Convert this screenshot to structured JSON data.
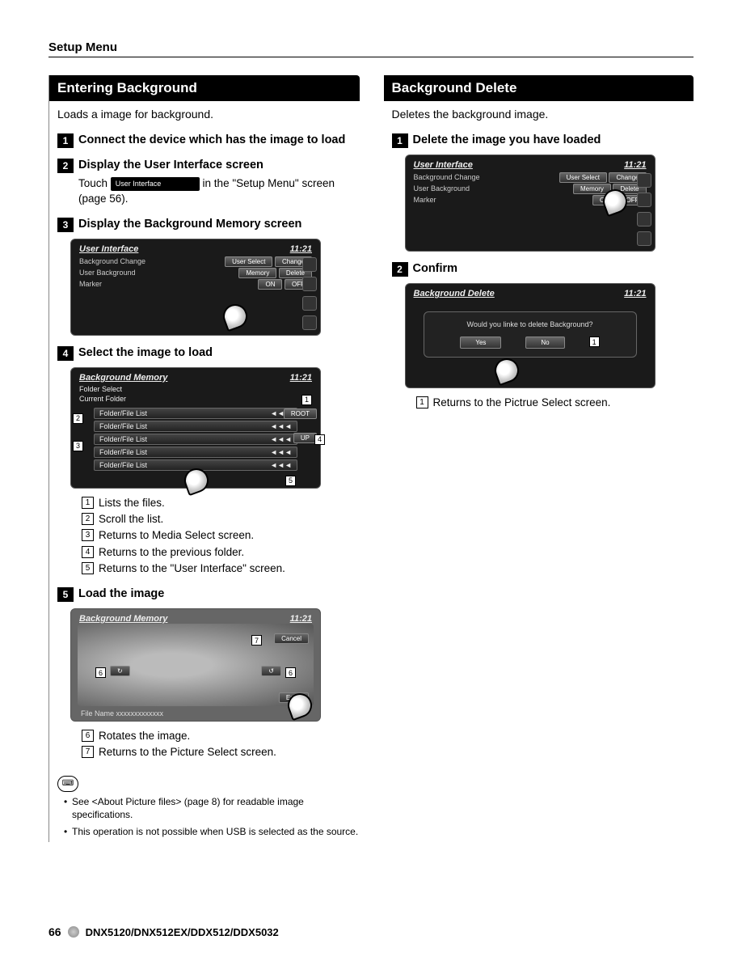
{
  "watermark": "",
  "header": "Setup Menu",
  "footer": {
    "page": "66",
    "models": "DNX5120/DNX512EX/DDX512/DDX5032"
  },
  "left": {
    "section_title": "Entering Background",
    "intro": "Loads a image for background.",
    "step1": {
      "num": "1",
      "title": "Connect the device which has the image to load"
    },
    "step2": {
      "num": "2",
      "title": "Display the User Interface screen",
      "body_pre": "Touch ",
      "inline_btn": "User Interface",
      "body_post": " in the \"Setup Menu\" screen (page 56)."
    },
    "step3": {
      "num": "3",
      "title": "Display the Background Memory screen",
      "ui": {
        "title": "User Interface",
        "time": "11:21",
        "row1_label": "Background Change",
        "row1_btn1": "User Select",
        "row1_btn2": "Change",
        "row2_label": "User Background",
        "row2_btn1": "Memory",
        "row2_btn2": "Delete",
        "row3_label": "Marker",
        "row3_on": "ON",
        "row3_off": "OFF"
      }
    },
    "step4": {
      "num": "4",
      "title": "Select the image to load",
      "ui": {
        "title": "Background Memory",
        "time": "11:21",
        "sub1": "Folder Select",
        "sub2": "Current Folder",
        "item": "Folder/File List",
        "arrows": "◄◄◄",
        "root": "ROOT",
        "up": "UP"
      },
      "callouts": [
        "Lists the files.",
        "Scroll the list.",
        "Returns to Media Select screen.",
        "Returns to the previous folder.",
        "Returns to the \"User Interface\" screen."
      ]
    },
    "step5": {
      "num": "5",
      "title": "Load the image",
      "ui": {
        "title": "Background Memory",
        "time": "11:21",
        "cancel": "Cancel",
        "enter": "Enter",
        "filename": "File Name xxxxxxxxxxxxx"
      },
      "callouts": [
        "Rotates the image.",
        "Returns to the Picture Select screen."
      ]
    },
    "notes": [
      "See <About Picture files> (page 8) for readable image specifications.",
      "This operation is not possible when USB is selected as the source."
    ]
  },
  "right": {
    "section_title": "Background Delete",
    "intro": "Deletes the background image.",
    "step1": {
      "num": "1",
      "title": "Delete the image you have loaded",
      "ui": {
        "title": "User Interface",
        "time": "11:21",
        "row1_label": "Background Change",
        "row1_btn1": "User Select",
        "row1_btn2": "Change",
        "row2_label": "User Background",
        "row2_btn1": "Memory",
        "row2_btn2": "Delete",
        "row3_label": "Marker",
        "row3_on": "ON",
        "row3_off": "OFF"
      }
    },
    "step2": {
      "num": "2",
      "title": "Confirm",
      "ui": {
        "title": "Background Delete",
        "time": "11:21",
        "msg": "Would you linke to delete Background?",
        "yes": "Yes",
        "no": "No"
      },
      "callouts": [
        "Returns to the Pictrue Select screen."
      ]
    }
  }
}
